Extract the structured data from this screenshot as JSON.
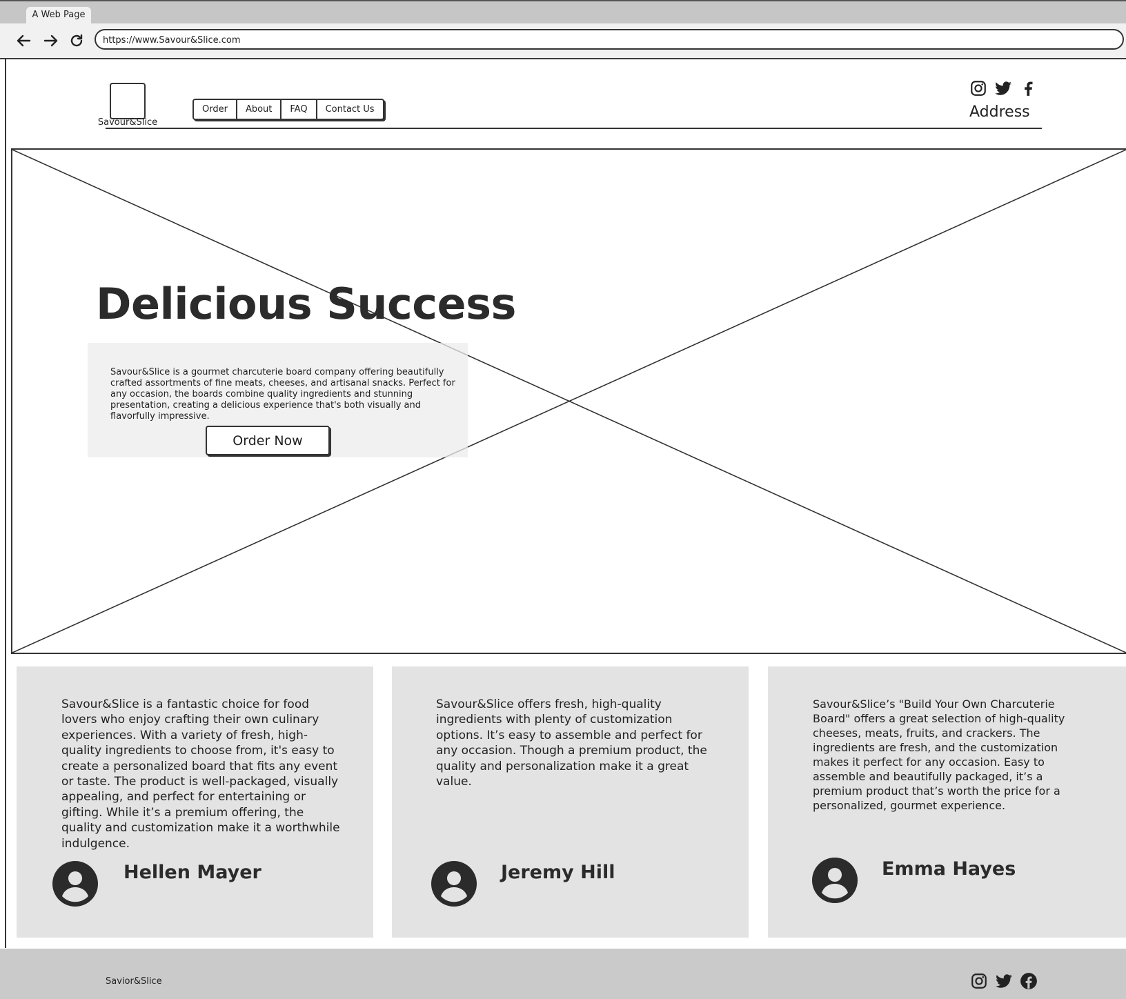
{
  "browser": {
    "tab_title": "A Web Page",
    "url": "https://www.Savour&Slice.com"
  },
  "header": {
    "logo_text": "Savour&Slice",
    "nav": [
      {
        "label": "Order"
      },
      {
        "label": "About"
      },
      {
        "label": "FAQ"
      },
      {
        "label": "Contact Us"
      }
    ],
    "social_icons": [
      "instagram-icon",
      "twitter-icon",
      "facebook-icon"
    ],
    "address_label": "Address"
  },
  "hero": {
    "title": "Delicious Success",
    "description": "Savour&Slice is a gourmet charcuterie board company offering beautifully crafted assortments of fine meats, cheeses, and artisanal snacks. Perfect for any occasion, the boards combine quality ingredients and stunning presentation, creating a delicious experience that's both visually and flavorfully impressive.",
    "cta_label": "Order Now"
  },
  "testimonials": [
    {
      "text": "Savour&Slice is a fantastic choice for food lovers who enjoy crafting their own culinary experiences. With a variety of fresh, high-quality ingredients to choose from, it's easy to create a personalized board that fits any event or taste. The product is well-packaged, visually appealing, and perfect for entertaining or gifting. While it’s a premium offering, the quality and customization make it a worthwhile indulgence.",
      "name": "Hellen Mayer"
    },
    {
      "text": "Savour&Slice offers fresh, high-quality ingredients with plenty of customization options. It’s easy to assemble and perfect for any occasion. Though a premium product, the quality and personalization make it a great value.",
      "name": "Jeremy Hill"
    },
    {
      "text": "Savour&Slice’s \"Build Your Own Charcuterie Board\" offers a great selection of high-quality cheeses, meats, fruits, and crackers. The ingredients are fresh, and the customization makes it perfect for any occasion. Easy to assemble and beautifully packaged, it’s a premium product that’s worth the price for a personalized, gourmet experience.",
      "name": "Emma Hayes"
    }
  ],
  "footer": {
    "brand": "Savior&Slice",
    "social_icons": [
      "instagram-icon",
      "twitter-icon",
      "facebook-icon"
    ]
  },
  "colors": {
    "ink": "#2b2b2b",
    "card_bg": "#e3e3e3",
    "footer_bg": "#cacaca",
    "chrome_bg": "#f1f1f1"
  }
}
